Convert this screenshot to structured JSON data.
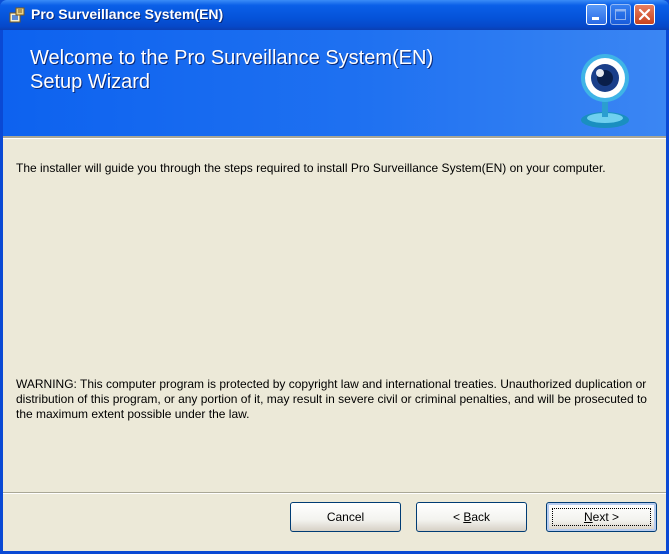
{
  "window": {
    "title": "Pro Surveillance System(EN)"
  },
  "banner": {
    "title_line1": "Welcome to the Pro Surveillance System(EN)",
    "title_line2": "Setup Wizard",
    "icon": "webcam-icon"
  },
  "body": {
    "intro": "The installer will guide you through the steps required to install Pro Surveillance System(EN) on your computer.",
    "warning": "WARNING: This computer program is protected by copyright law and international treaties. Unauthorized duplication or distribution of this program, or any portion of it, may result in severe civil or criminal penalties, and will be prosecuted to the maximum extent possible under the law."
  },
  "buttons": {
    "cancel": "Cancel",
    "back_prefix": "< ",
    "back_hotkey": "B",
    "back_rest": "ack",
    "next_hotkey": "N",
    "next_rest": "ext >"
  },
  "colors": {
    "title_bar": "#0553d9",
    "banner": "#1f71f1",
    "dialog_face": "#ece9d8",
    "close_button": "#c8421e"
  }
}
